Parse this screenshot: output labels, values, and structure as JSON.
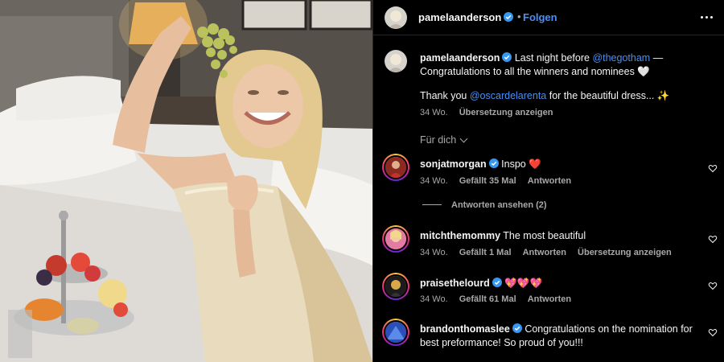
{
  "post": {
    "username": "pamelaanderson",
    "dot": "•",
    "follow_label": "Folgen",
    "more_icon": "more-horizontal-icon"
  },
  "caption": {
    "username": "pamelaanderson",
    "text_before": "Last night before",
    "mention1": "@thegotham",
    "text_mid": "— Congratulations to all the winners and nominees 🤍",
    "line2_before": "Thank you",
    "mention2": "@oscardelarenta",
    "line2_after": "for the beautiful dress... ✨",
    "time": "34 Wo.",
    "translate": "Übersetzung anzeigen"
  },
  "for_you": "Für dich",
  "comments": [
    {
      "username": "sonjatmorgan",
      "verified": true,
      "text": "Inspo ❤️",
      "time": "34 Wo.",
      "likes": "Gefällt 35 Mal",
      "reply": "Antworten",
      "view_replies": "Antworten ansehen (2)"
    },
    {
      "username": "mitchthemommy",
      "verified": false,
      "text": "The most beautiful",
      "time": "34 Wo.",
      "likes": "Gefällt 1 Mal",
      "reply": "Antworten",
      "translate": "Übersetzung anzeigen"
    },
    {
      "username": "praisethelourd",
      "verified": true,
      "text": "💖💖💖",
      "time": "34 Wo.",
      "likes": "Gefällt 61 Mal",
      "reply": "Antworten"
    },
    {
      "username": "brandonthomaslee",
      "verified": true,
      "text": "Congratulations on the nomination for best preformance! So proud of you!!!"
    }
  ],
  "colors": {
    "link": "#4a8ff5",
    "verified": "#3897f0",
    "muted": "#a8a8a8",
    "background": "#000000"
  }
}
